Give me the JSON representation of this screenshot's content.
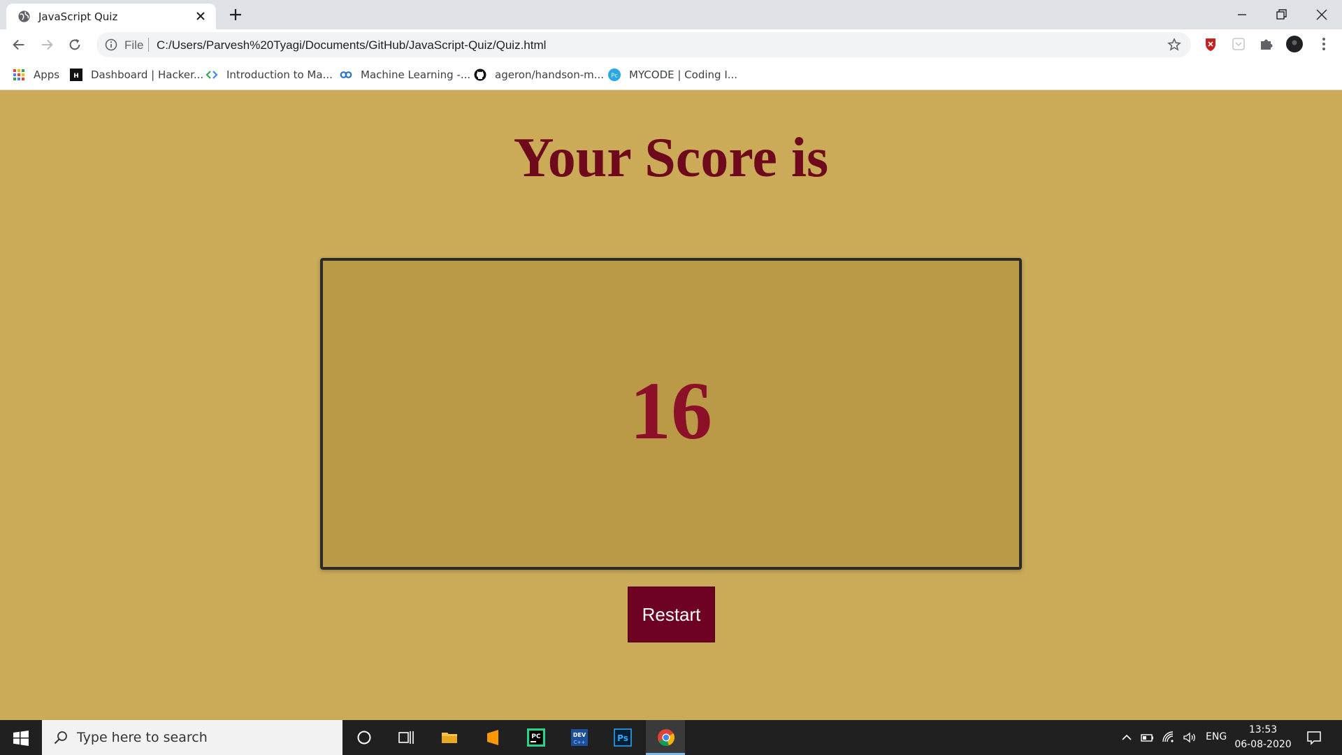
{
  "browser": {
    "tab_title": "JavaScript Quiz",
    "address_scheme": "File",
    "address_url": "C:/Users/Parvesh%20Tyagi/Documents/GitHub/JavaScript-Quiz/Quiz.html",
    "bookmarks": [
      {
        "label": "Apps",
        "icon": "apps-grid-icon"
      },
      {
        "label": "Dashboard | Hacker...",
        "icon": "hackerrank-icon"
      },
      {
        "label": "Introduction to Ma...",
        "icon": "code-brackets-icon"
      },
      {
        "label": "Machine Learning -...",
        "icon": "coursera-icon"
      },
      {
        "label": "ageron/handson-m...",
        "icon": "github-icon"
      },
      {
        "label": "MYCODE | Coding I...",
        "icon": "mycode-icon"
      }
    ]
  },
  "page": {
    "heading": "Your Score is",
    "score": "16",
    "restart_label": "Restart"
  },
  "taskbar": {
    "search_placeholder": "Type here to search",
    "language": "ENG",
    "time": "13:53",
    "date": "06-08-2020"
  },
  "colors": {
    "page_background": "#cbab58",
    "score_box_background": "#bb9a47",
    "heading_color": "#6e0a1c",
    "score_color": "#8b1028",
    "button_background": "#6e0222"
  }
}
